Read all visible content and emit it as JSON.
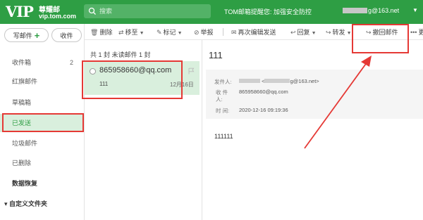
{
  "header": {
    "logo_vip": "VIP",
    "logo_name": "尊耀邮",
    "logo_domain": "vip.tom.com",
    "search_placeholder": "搜索",
    "promo": "TOM邮箱提醒您: 加强安全防控",
    "user_email_suffix": "g@163.net",
    "user_caret": "▼"
  },
  "sidebar": {
    "compose_label": "写邮件",
    "inbox_button_label": "收件",
    "folders": [
      {
        "label": "收件箱",
        "count": "2"
      },
      {
        "label": "红旗邮件",
        "count": ""
      },
      {
        "label": "草稿箱",
        "count": ""
      },
      {
        "label": "已发送",
        "count": "",
        "active": true
      },
      {
        "label": "垃圾邮件",
        "count": ""
      },
      {
        "label": "已删除",
        "count": ""
      },
      {
        "label": "数据恢复",
        "count": ""
      }
    ],
    "custom_folders": "自定义文件夹"
  },
  "toolbar": {
    "delete": "删除",
    "move": "移至",
    "mark": "标记",
    "report": "举报",
    "resend": "再次编辑发送",
    "reply": "回复",
    "forward": "转发",
    "recall": "撤回邮件",
    "more": "更"
  },
  "list": {
    "summary": "共 1 封  未读邮件 1 封",
    "items": [
      {
        "sender": "865958660@qq.com",
        "subject": "111",
        "date": "12月16日"
      }
    ]
  },
  "reader": {
    "title": "111",
    "from_label": "发件人:",
    "from_value_prefix": "<",
    "from_value_suffix": "g@163.net>",
    "to_label": "收 件",
    "to_label2": "人:",
    "to_value": "865958660@qq.com",
    "time_label": "时  间:",
    "time_value": "2020-12-16 09:19:36",
    "body": "111111"
  },
  "colors": {
    "brand_green": "#2e9e44",
    "highlight_red": "#e53935",
    "selected_bg": "#d9efdd"
  }
}
